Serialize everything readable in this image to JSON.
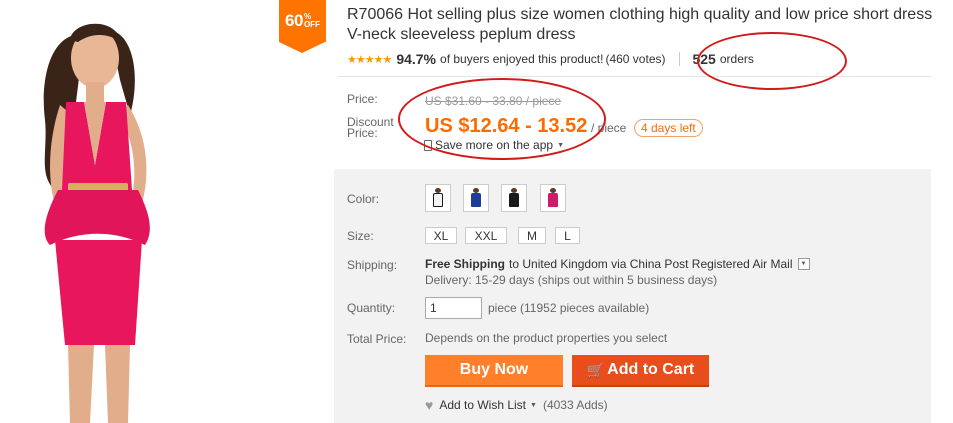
{
  "discount_badge": {
    "number": "60",
    "percent": "%",
    "off": "OFF"
  },
  "product": {
    "title": "R70066 Hot selling plus size women clothing high quality and low price short dress V-neck sleeveless peplum dress"
  },
  "rating": {
    "stars": "★★★★★",
    "percent": "94.7%",
    "text": "of buyers enjoyed this product!",
    "votes": "(460 votes)"
  },
  "orders": {
    "count": "525",
    "label": "orders"
  },
  "price": {
    "label": "Price:",
    "original": "US $31.60 - 33.80 / piece",
    "discount_label_1": "Discount",
    "discount_label_2": "Price:",
    "discount": "US $12.64 - 13.52",
    "per_piece": "/ piece",
    "days_left": "4 days left",
    "app_saving": "Save more on the app"
  },
  "options": {
    "color_label": "Color:",
    "colors": [
      {
        "name": "white-black",
        "hex": "#f4f4f4",
        "accent": "#1a1a1a"
      },
      {
        "name": "blue",
        "hex": "#1f3c9a",
        "accent": "#1f3c9a"
      },
      {
        "name": "black",
        "hex": "#1a1a1a",
        "accent": "#6a4a3a"
      },
      {
        "name": "rose",
        "hex": "#d01a6a",
        "accent": "#d01a6a"
      }
    ],
    "size_label": "Size:",
    "sizes": [
      "XL",
      "XXL",
      "M",
      "L"
    ],
    "shipping_label": "Shipping:",
    "shipping_free": "Free Shipping",
    "shipping_rest": "to United Kingdom via China Post Registered Air Mail",
    "delivery": "Delivery: 15-29 days (ships out within 5 business days)",
    "quantity_label": "Quantity:",
    "quantity_value": "1",
    "quantity_available": "piece (11952 pieces available)",
    "total_label": "Total Price:",
    "total_value": "Depends on the product properties you select"
  },
  "actions": {
    "buy_now": "Buy Now",
    "add_to_cart": "Add to Cart",
    "wish_list": "Add to Wish List",
    "wish_count": "(4033 Adds)"
  },
  "colors": {
    "accent_orange": "#ff6a00",
    "buy_button": "#ff7f2a",
    "cart_button": "#e84d1c",
    "dress_pink": "#e8175d",
    "annotation_red": "#d11a1a"
  }
}
